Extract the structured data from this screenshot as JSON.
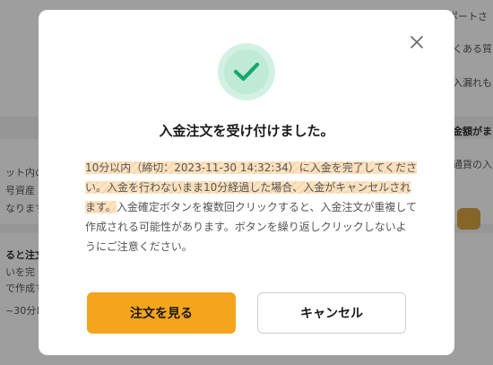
{
  "background": {
    "right_texts": [
      "ポートさ",
      "くある質",
      "入漏れも",
      "金額がま",
      "通貨の入"
    ],
    "left_texts": [
      "ット内の",
      "号資産",
      "なります",
      "ると注文",
      "いを完",
      "で作成す",
      "~30分以"
    ]
  },
  "modal": {
    "title": "入金注文を受け付けました。",
    "message_highlight": "10分以内（締切：2023-11-30 14:32:34）に入金を完了してください。入金を行わないまま10分経過した場合、入金がキャンセルされます。",
    "message_rest": "入金確定ボタンを複数回クリックすると、入金注文が重複して作成される可能性があります。ボタンを繰り返しクリックしないようにご注意ください。",
    "primary_button": "注文を見る",
    "secondary_button": "キャンセル"
  },
  "colors": {
    "accent": "#f5a41e",
    "success": "#17a96b",
    "highlight": "#fce5c6"
  },
  "icons": {
    "close": "close-icon",
    "success": "check-icon"
  }
}
